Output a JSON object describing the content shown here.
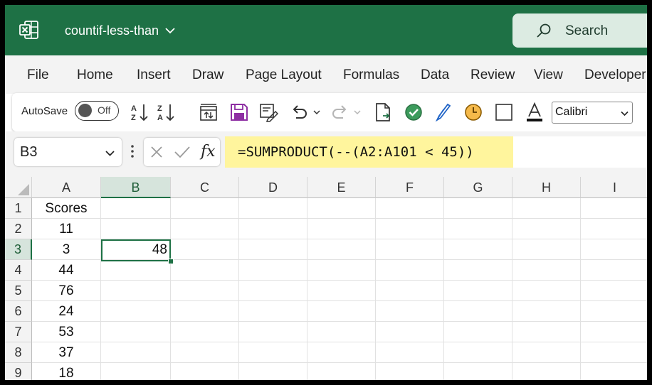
{
  "titlebar": {
    "doc_title": "countif-less-than",
    "search_label": "Search",
    "accent": "#1e7145"
  },
  "menu": {
    "items": [
      "File",
      "Home",
      "Insert",
      "Draw",
      "Page Layout",
      "Formulas",
      "Data",
      "Review",
      "View",
      "Developer"
    ]
  },
  "toolbar": {
    "autosave_label": "AutoSave",
    "autosave_state": "Off",
    "icons": [
      "sort-ascending-icon",
      "sort-descending-icon",
      "refresh-all-icon",
      "save-icon",
      "form-icon",
      "undo-icon",
      "redo-icon",
      "document-icon",
      "accessibility-checker-icon",
      "draw-pen-icon",
      "clock-icon",
      "borders-icon",
      "font-color-icon"
    ],
    "font_value": "Calibri"
  },
  "formula_bar": {
    "name_box": "B3",
    "fx_label": "fx",
    "formula": "=SUMPRODUCT(--(A2:A101 < 45))",
    "highlight_color": "#fff59d"
  },
  "grid": {
    "columns": [
      "A",
      "B",
      "C",
      "D",
      "E",
      "F",
      "G",
      "H",
      "I"
    ],
    "selected_column": "B",
    "rows": [
      {
        "num": "1",
        "A": "Scores",
        "B": ""
      },
      {
        "num": "2",
        "A": "11",
        "B": ""
      },
      {
        "num": "3",
        "A": "3",
        "B": "48"
      },
      {
        "num": "4",
        "A": "44",
        "B": ""
      },
      {
        "num": "5",
        "A": "76",
        "B": ""
      },
      {
        "num": "6",
        "A": "24",
        "B": ""
      },
      {
        "num": "7",
        "A": "53",
        "B": ""
      },
      {
        "num": "8",
        "A": "37",
        "B": ""
      },
      {
        "num": "9",
        "A": "18",
        "B": ""
      }
    ],
    "selected_row": "3"
  }
}
